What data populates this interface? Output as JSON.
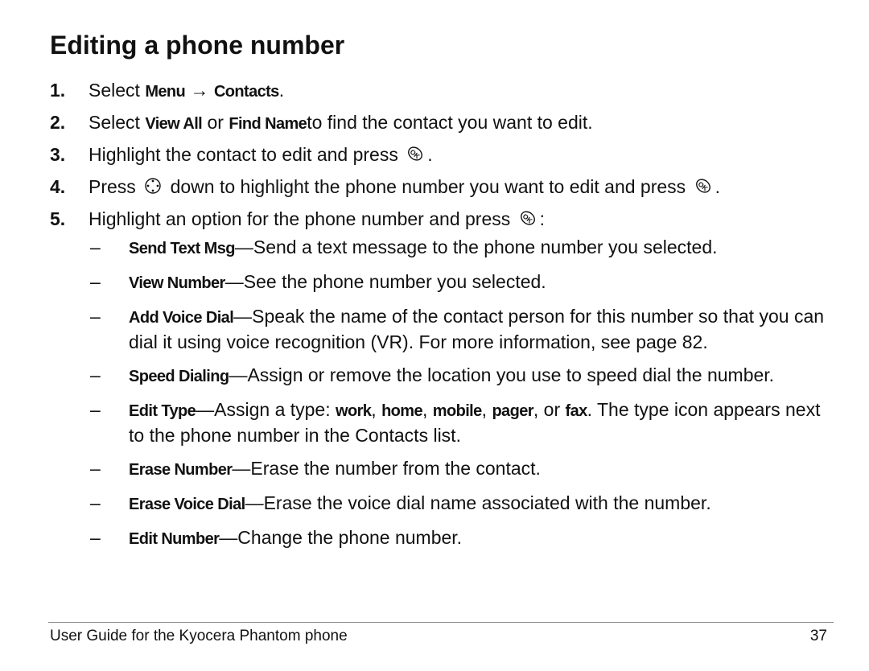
{
  "title": "Editing a phone number",
  "steps": [
    {
      "num": "1.",
      "parts": [
        {
          "t": "Select "
        },
        {
          "b": "Menu"
        },
        {
          "t": " → "
        },
        {
          "b": "Contacts"
        },
        {
          "t": "."
        }
      ]
    },
    {
      "num": "2.",
      "parts": [
        {
          "t": "Select "
        },
        {
          "b": "View All"
        },
        {
          "t": " or "
        },
        {
          "b": "Find Name"
        },
        {
          "t": "to find the contact you want to edit."
        }
      ]
    },
    {
      "num": "3.",
      "parts": [
        {
          "t": "Highlight the contact to edit and press "
        },
        {
          "icon": "ok-key"
        },
        {
          "t": "."
        }
      ]
    },
    {
      "num": "4.",
      "parts": [
        {
          "t": "Press "
        },
        {
          "icon": "nav-key"
        },
        {
          "t": " down to highlight the phone number you want to edit and press "
        },
        {
          "icon": "ok-key"
        },
        {
          "t": "."
        }
      ]
    },
    {
      "num": "5.",
      "parts": [
        {
          "t": "Highlight an option for the phone number and press "
        },
        {
          "icon": "ok-key"
        },
        {
          "t": ":"
        }
      ]
    }
  ],
  "options": [
    {
      "dash": "–",
      "parts": [
        {
          "b": "Send Text Msg"
        },
        {
          "t": "—Send a text message to the phone number you selected."
        }
      ]
    },
    {
      "dash": "–",
      "parts": [
        {
          "b": "View Number"
        },
        {
          "t": "—See the phone number you selected."
        }
      ]
    },
    {
      "dash": "–",
      "parts": [
        {
          "b": "Add Voice Dial"
        },
        {
          "t": "—Speak the name of the contact person for this number so that you can dial it using voice recognition (VR). For more information, see page 82."
        }
      ]
    },
    {
      "dash": "–",
      "parts": [
        {
          "b": "Speed Dialing"
        },
        {
          "t": "—Assign or remove the location you use to speed dial the number."
        }
      ]
    },
    {
      "dash": "–",
      "parts": [
        {
          "b": "Edit Type"
        },
        {
          "t": "—Assign a type: "
        },
        {
          "b": "work"
        },
        {
          "t": ", "
        },
        {
          "b": "home"
        },
        {
          "t": ", "
        },
        {
          "b": "mobile"
        },
        {
          "t": ", "
        },
        {
          "b": "pager"
        },
        {
          "t": ", or "
        },
        {
          "b": "fax"
        },
        {
          "t": ". The type icon appears next to the phone number in the Contacts list."
        }
      ]
    },
    {
      "dash": "–",
      "parts": [
        {
          "b": "Erase Number"
        },
        {
          "t": "—Erase the number from the contact."
        }
      ]
    },
    {
      "dash": "–",
      "parts": [
        {
          "b": "Erase Voice Dial"
        },
        {
          "t": "—Erase the voice dial name associated with the number."
        }
      ]
    },
    {
      "dash": "–",
      "parts": [
        {
          "b": "Edit Number"
        },
        {
          "t": "—Change the phone number."
        }
      ]
    }
  ],
  "footer": {
    "left": "User Guide for the Kyocera Phantom phone",
    "page": "37"
  }
}
